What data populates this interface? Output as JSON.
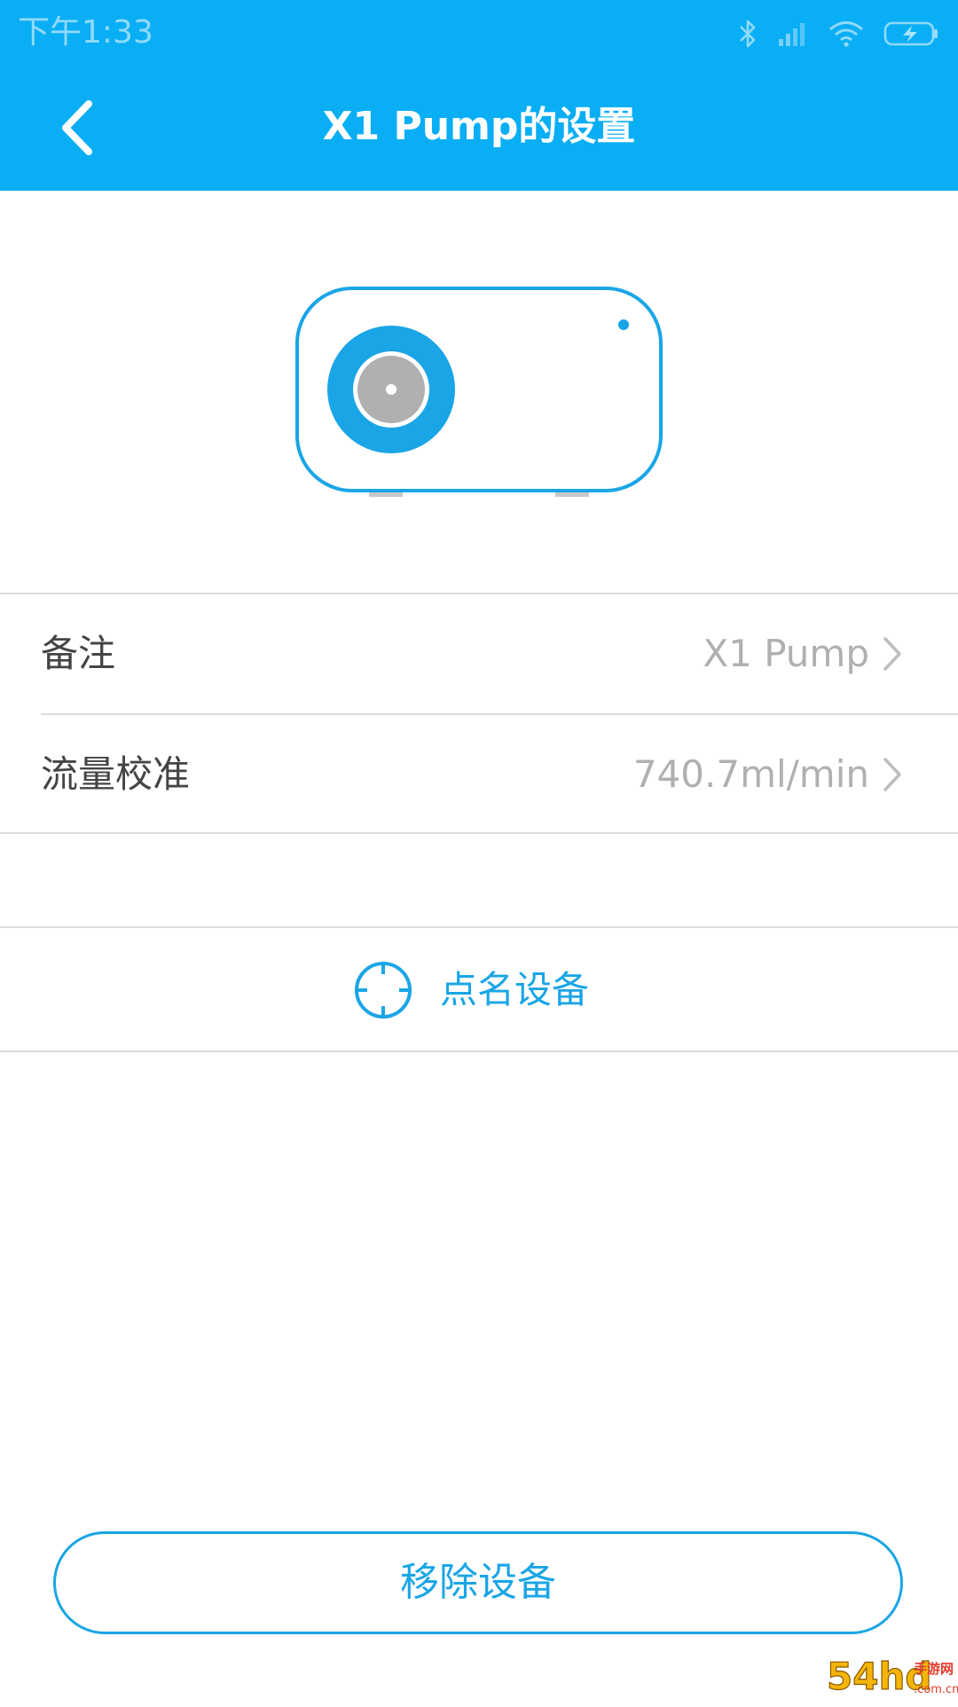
{
  "status_bar": {
    "time": "下午1:33",
    "icons": [
      "bluetooth-icon",
      "signal-icon",
      "wifi-icon",
      "battery-charging-icon"
    ]
  },
  "header": {
    "title": "X1 Pump的设置",
    "back_icon": "chevron-left-icon"
  },
  "device": {
    "illustration": "pump-device-illustration"
  },
  "settings": {
    "items": [
      {
        "label": "备注",
        "value": "X1 Pump"
      },
      {
        "label": "流量校准",
        "value": "740.7ml/min"
      }
    ]
  },
  "identify": {
    "label": "点名设备",
    "icon": "crosshair-icon"
  },
  "remove": {
    "label": "移除设备"
  },
  "watermark": {
    "text": "54hd手游网 .com.cn"
  },
  "colors": {
    "header_bg": "#0AAEF4",
    "accent": "#1AA5E6",
    "label_text": "#444444",
    "value_text": "#B0B0B0",
    "divider": "#DCDCDC"
  }
}
